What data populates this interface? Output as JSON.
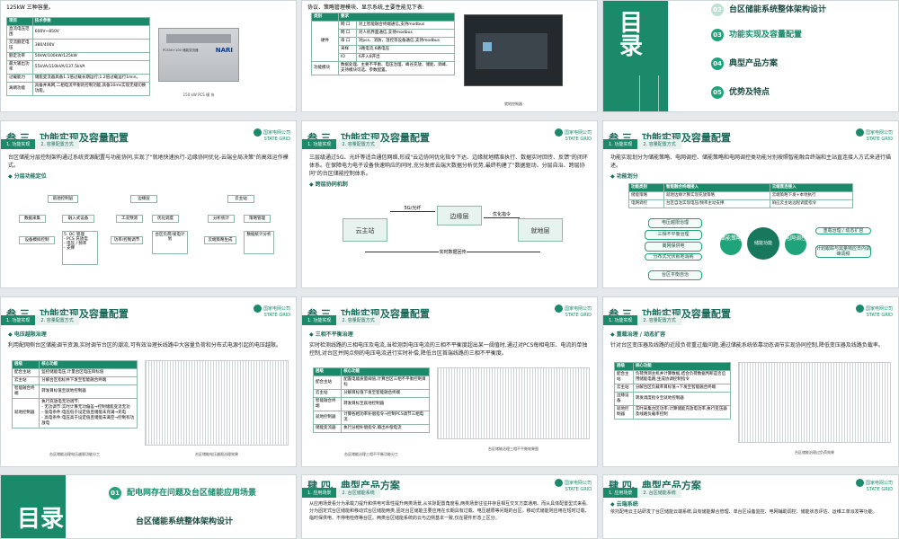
{
  "common": {
    "logo_line1": "国家电网公司",
    "logo_line2": "STATE GRID",
    "tab1": "1. 功能实现",
    "tab2": "2. 容量配置方式"
  },
  "s1": {
    "intro": "125kW 三种容量。",
    "table_head": [
      "项目",
      "技术参数"
    ],
    "rows": [
      [
        "直流电压范围",
        "600V~850V"
      ],
      [
        "交流额定电压",
        "380/400V"
      ],
      [
        "额定功率",
        "50kW/100kW/125kW"
      ],
      [
        "最大输出功率",
        "55kVA/110kVA/137.5kVA"
      ],
      [
        "过载能力",
        "储能变流器具备1.1倍过载长期运行;1.2倍过载运行1min。"
      ],
      [
        "离網功能",
        "具备并离网,二相电流平衡的控制功能,具备10ms实现无缝切换功能。"
      ]
    ],
    "img_brand": "NARI",
    "img_label": "PCS50+100 储能变流器",
    "caption": "150 kW PCS 模 块"
  },
  "s2": {
    "intro": "协议、策略管理模块、显示系统,主要性能见下表:",
    "head": [
      "类别",
      "要求"
    ],
    "cat": "硬件",
    "rows": [
      [
        "网 口",
        "对上智能融合终端通信,支持modbus"
      ],
      [
        "网 口",
        "对人机界面通信,支持modbus"
      ],
      [
        "串 口",
        "对pcs、消防、温控等设备通信,支持modbus"
      ],
      [
        "采样",
        "3路电流,6路电压"
      ],
      [
        "IO",
        "6开入8开出"
      ],
      [
        "功能模块",
        "数据处理、主要不平衡、电压治理、峰谷充放、储能、调峰、支持模块可选、参数配置。"
      ]
    ],
    "caption": "就地控制器"
  },
  "s3": {
    "big": "目录",
    "items": [
      {
        "num": "02",
        "label": "台区储能系统整体架构设计"
      },
      {
        "num": "03",
        "label": "功能实现及容量配置"
      },
      {
        "num": "04",
        "label": "典型产品方案"
      },
      {
        "num": "05",
        "label": "优势及特点"
      }
    ]
  },
  "s4": {
    "title": "叁  三、功能实现及容量配置",
    "text": "台区储能分层控制架构通过系统资源配置与功能协同,实现了\"就地快速执行-边缘协同优化-云端全局决策\"的高效运作模式。",
    "sub": "◆ 分层功能定位",
    "boxes": [
      "就地控制层",
      "边缘层",
      "云主站",
      "数据采集",
      "融入式设备",
      "工况预测",
      "优化调度",
      "分析统计",
      "策略管理",
      "设备模拟控制",
      "5. OC 管理\n- PCS 充放电\n- 电压 / 频率\n- 支撑",
      "功率/控制调节",
      "区域调节",
      "台区负荷/发电计划",
      "数据统计分析",
      "云端策略生成"
    ]
  },
  "s5": {
    "title": "叁  三、功能实现及容量配置",
    "text": "三层级通过5G、光纤等适合通信网络,形成\"云边协同优化指令下达、边缘就地精准执行、数据实时回传、反馈\"的闭环体系。在保障电力电子设备快速响应的同时,充分发挥云端大数据分析优势,最终构建了\"数据驱动、分层自治、跨层协同\"的台区储能控制体系。",
    "sub": "◆ 跨层协同机制",
    "cloud": "云主站",
    "edge": "边缘层",
    "local": "就地层",
    "l1": "5G/光纤",
    "l2": "优化指令",
    "l3": "实时数据回传"
  },
  "s6": {
    "title": "叁  三、功能实现及容量配置",
    "text": "功能实现划分为储能策略、电网调控、储能策略和电网调控类功能分别按照智能融合终端和主站直连接入方式来进行描述。",
    "sub": "◆ 功能划分",
    "head": [
      "功能类别",
      "智能融合终端接入",
      "云端直连接入"
    ],
    "rows": [
      [
        "储能策略",
        "就地边缘计算实现充放策略",
        "云端策略下发+本地执行"
      ],
      [
        "电网调控",
        "台区自治实现电压/频率主动支撑",
        "响应云主站远程调度指令"
      ]
    ],
    "left": [
      "电压越限治理",
      "三相不平衡治理",
      "离网保供电",
      "分布式光伏就地消纳",
      "台区平衡自治"
    ],
    "c1": "储能策略",
    "c2": "电网调控",
    "right": [
      "重载治理 / 动态扩容",
      "计划跟踪与需量响应日内调峰调频"
    ],
    "center": "储能功能"
  },
  "s7": {
    "title": "叁  三、功能实现及容量配置",
    "sub": "◆ 电压越限治理",
    "text": "利用配网侧台区储能调节资源,实时调节台区的潮流,可有效治理长线路中大容量负荷和分布式电源引起的电压越限。",
    "head": [
      "层级",
      "核心功能"
    ],
    "rows": [
      [
        "配合主站",
        "监控储能电压,计量台区电压目标值"
      ],
      [
        "云主站",
        "分解台区指标并下发至智能融合终端"
      ],
      [
        "智能融合终端",
        "转发目标值至就地控制器"
      ],
      [
        "就地控制器",
        "执行充放电无功调节;\n- 无功调节:实时计算无功偏差→控制储能变流无功\n- 低电条件:电压低于设定值且储能未充满→充电\n- 高电条件:电压高于设定值且储能未满空→控制有功放电"
      ]
    ],
    "cap1": "台区储能治理电压越限功能分工",
    "cap2": "台区储能电压越限治理效果"
  },
  "s8": {
    "title": "叁  三、功能实现及容量配置",
    "sub": "◆ 三相不平衡治理",
    "text": "实时检测线路的三相电压及电流,当检测到电压电流的三相不平衡度超出某一阈值时,通过对PCS每相电压、电流的单独控制,对台区并网点侧的电压电流进行实时补偿,降低台区首端线路的三相不平衡度。",
    "head": [
      "层级",
      "核心功能"
    ],
    "rows": [
      [
        "配合主站",
        "配置电能质量阈值,计算台区三相不平衡控制目标"
      ],
      [
        "云主站",
        "分解目标值下发至智能融合终端"
      ],
      [
        "智能融合终端",
        "转发目标至就地控制器"
      ],
      [
        "就地控制器",
        "计算各相功率补偿指令→控制PCS调节三相电流"
      ],
      [
        "储能变流器",
        "执行分相补偿指令,输出补偿电流"
      ]
    ],
    "cap1": "台区储能治理三相不平衡功能分工",
    "cap2": "台区储能治理三相不平衡效果图"
  },
  "s9": {
    "title": "叁  三、功能实现及容量配置",
    "sub": "◆ 重载治理 / 动态扩容",
    "text": "针对台区变压器及线路的近段负荷重过载问题,通过储能系统依靠动态调节实现协同控制,降低变压器及线路负载率。",
    "head": [
      "层级",
      "核心功能"
    ],
    "rows": [
      [
        "配合主站",
        "负荷预测主机并计算数据,结合负荷数据判断是否启用储能电路;生成协调控制指令"
      ],
      [
        "云主站",
        "分解台区负载率目标值→下发至智能融合终端"
      ],
      [
        "边缘设备",
        "转发调度指令至就地控制器"
      ],
      [
        "就地控制器",
        "实时采集台区功率;计算储能充放电功率,执行变压器及线路负载率控制"
      ]
    ],
    "cap": "台区储能治理过负荷效果"
  },
  "s10": {
    "big": "目录",
    "items": [
      {
        "num": "01",
        "label": "配电网存在问题及台区储能应用场景"
      },
      {
        "num": "02",
        "label": "台区储能系统整体架构设计"
      }
    ]
  },
  "s11": {
    "title": "肆  四、典型产品方案",
    "tab1": "1. 应用场景",
    "tab2": "2. 台区储能系统",
    "text": "从应用场景看分为承载力提升和供电可靠性提升两类场景,从实际配置角度看,两类场景往往并存且相互交叉方案通用。而从具体配置型式来看,分为固定式台区储能和移动式台区储能两类,固定台区储能主要应用在长期具有过载、电压越限等问题的台区。移动式储能则应用在短时过载、临时保供电、不停电检修等台区。两类台区储能系统的云与边侧基本一致,仅在硬件形态上区分。"
  },
  "s12": {
    "title": "肆  四、典型产品方案",
    "tab1": "1. 应用场景",
    "tab2": "2. 台区储能系统",
    "sub": "◆ 云端系统",
    "text": "依托配电云主站研发了台区储能云端系统,具有储能聚合管理、单台区设备监控、电网辅助调控、储能状态评估、运维工单派发等功能。"
  }
}
